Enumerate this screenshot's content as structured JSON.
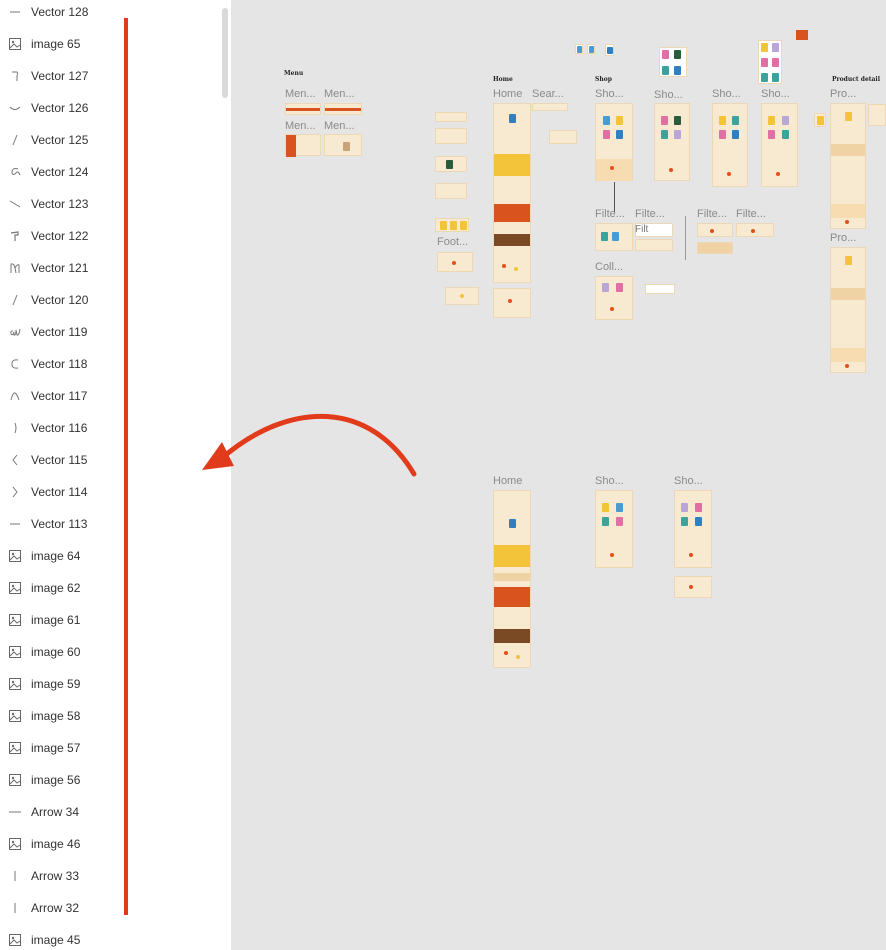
{
  "layers_panel": {
    "items": [
      {
        "label": "Vector 128",
        "icon": "vector-dash-icon"
      },
      {
        "label": "image 65",
        "icon": "image-icon"
      },
      {
        "label": "Vector 127",
        "icon": "vector-hook-icon"
      },
      {
        "label": "Vector 126",
        "icon": "vector-smile-icon"
      },
      {
        "label": "Vector 125",
        "icon": "vector-slash-icon"
      },
      {
        "label": "Vector 124",
        "icon": "vector-loop-icon"
      },
      {
        "label": "Vector 123",
        "icon": "vector-diagonal-icon"
      },
      {
        "label": "Vector 122",
        "icon": "vector-flag-icon"
      },
      {
        "label": "Vector 121",
        "icon": "vector-n-icon"
      },
      {
        "label": "Vector 120",
        "icon": "vector-slash-icon"
      },
      {
        "label": "Vector 119",
        "icon": "vector-scribble-icon"
      },
      {
        "label": "Vector 118",
        "icon": "vector-c-icon"
      },
      {
        "label": "Vector 117",
        "icon": "vector-caret-icon"
      },
      {
        "label": "Vector 116",
        "icon": "vector-paren-icon"
      },
      {
        "label": "Vector 115",
        "icon": "vector-less-than-icon"
      },
      {
        "label": "Vector 114",
        "icon": "vector-greater-than-icon"
      },
      {
        "label": "Vector 113",
        "icon": "vector-dash-icon"
      },
      {
        "label": "image 64",
        "icon": "image-icon"
      },
      {
        "label": "image 62",
        "icon": "image-icon"
      },
      {
        "label": "image 61",
        "icon": "image-icon"
      },
      {
        "label": "image 60",
        "icon": "image-icon"
      },
      {
        "label": "image 59",
        "icon": "image-icon"
      },
      {
        "label": "image 58",
        "icon": "image-icon"
      },
      {
        "label": "image 57",
        "icon": "image-icon"
      },
      {
        "label": "image 56",
        "icon": "image-icon"
      },
      {
        "label": "Arrow 34",
        "icon": "arrow-horizontal-icon"
      },
      {
        "label": "image 46",
        "icon": "image-icon"
      },
      {
        "label": "Arrow 33",
        "icon": "arrow-vertical-icon"
      },
      {
        "label": "Arrow 32",
        "icon": "arrow-vertical-icon"
      },
      {
        "label": "image 45",
        "icon": "image-icon"
      }
    ]
  },
  "canvas": {
    "section_titles": {
      "menu": "Menu",
      "home": "Home",
      "shop": "Shop",
      "product_detail": "Product detail"
    },
    "frame_labels": {
      "menu_1": "Men...",
      "menu_2": "Men...",
      "menu_3": "Men...",
      "menu_4": "Men...",
      "home_top": "Home",
      "search": "Sear...",
      "shop_1": "Sho...",
      "shop_2": "Sho...",
      "shop_3": "Sho...",
      "shop_4": "Sho...",
      "product_1": "Pro...",
      "product_2": "Pro...",
      "footer": "Foot...",
      "filter_1": "Filte...",
      "filter_2": "Filte...",
      "filter_3": "Filte...",
      "filter_4": "Filte...",
      "filter_overlay": "Filt",
      "collection": "Coll...",
      "home_bottom": "Home",
      "shop_bottom_1": "Sho...",
      "shop_bottom_2": "Sho..."
    }
  },
  "annotation": {
    "color": "#e23b1c"
  }
}
